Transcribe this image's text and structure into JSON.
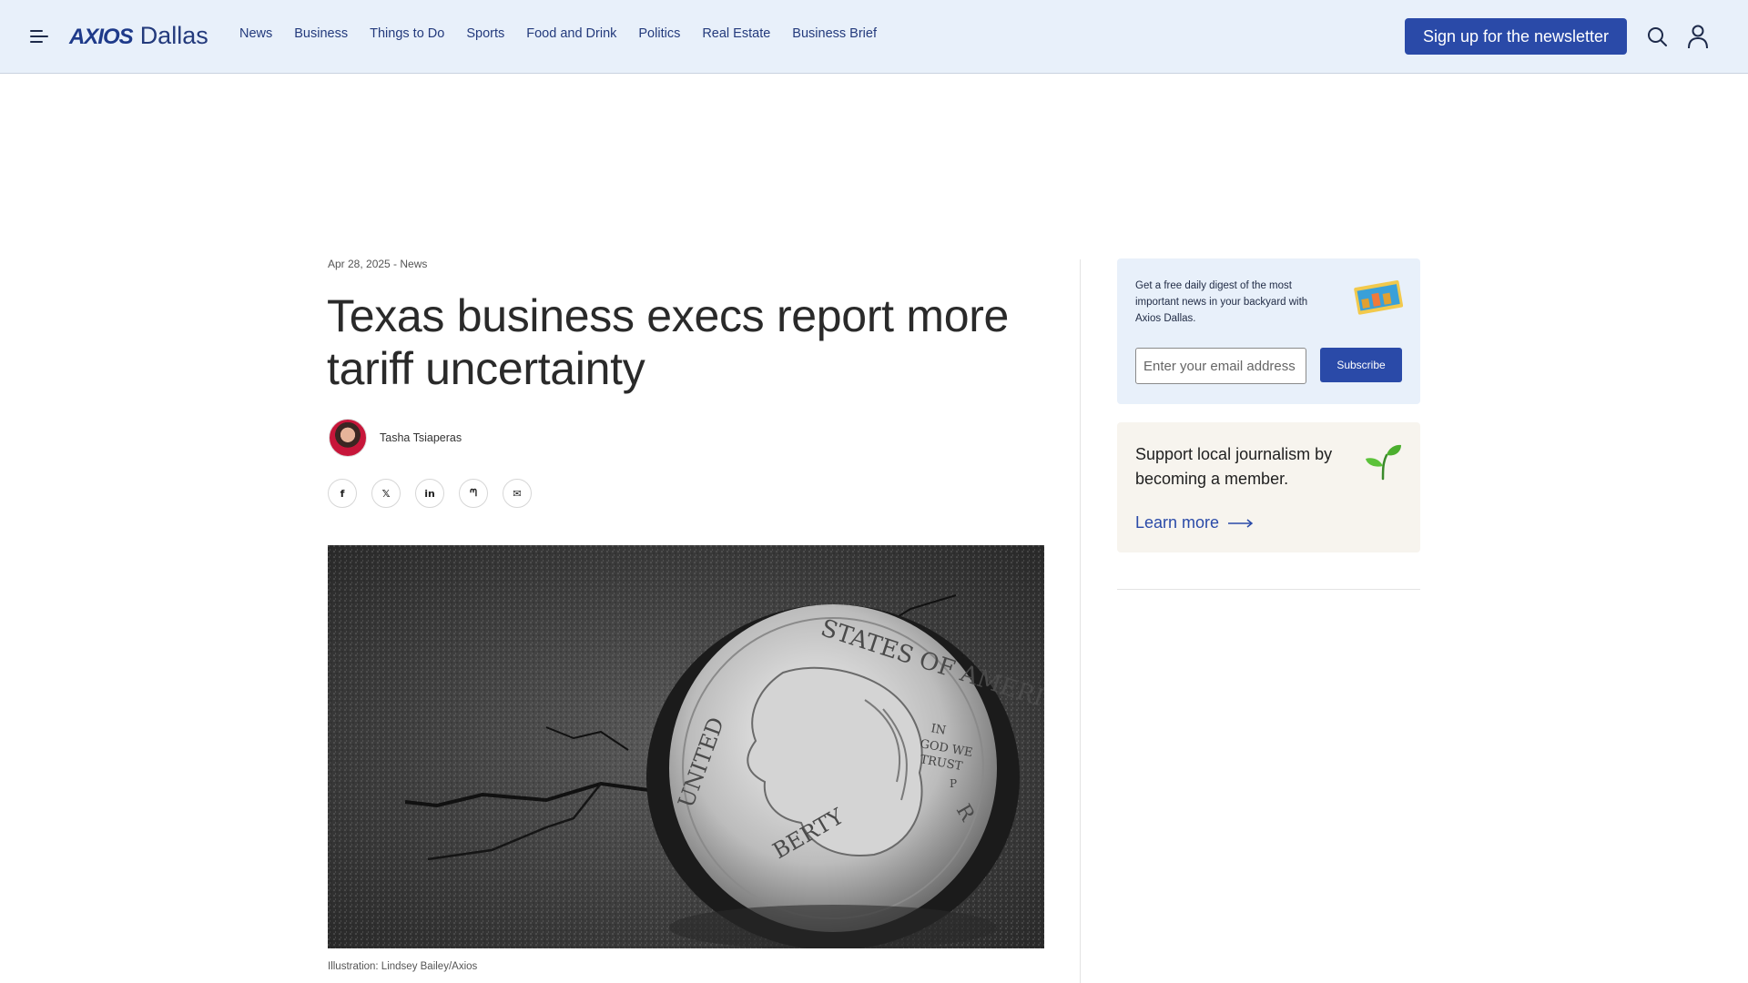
{
  "header": {
    "logo_brand": "AXIOS",
    "logo_city": "Dallas",
    "nav": [
      "News",
      "Business",
      "Things to Do",
      "Sports",
      "Food and Drink",
      "Politics",
      "Real Estate",
      "Business Brief"
    ],
    "signup_label": "Sign up for the newsletter",
    "icons": [
      "menu-icon",
      "search-icon",
      "user-icon"
    ],
    "background_color": "#e8f0fa",
    "accent_color": "#2a4aa8"
  },
  "article": {
    "dateline": "Apr 28, 2025 - News",
    "headline": "Texas business execs report more tariff uncertainty",
    "author": "Tasha Tsiaperas",
    "share_buttons": [
      {
        "name": "facebook",
        "glyph": "f"
      },
      {
        "name": "x",
        "glyph": "𝕏"
      },
      {
        "name": "linkedin",
        "glyph": "in"
      },
      {
        "name": "threads",
        "glyph": "ᘉ"
      },
      {
        "name": "email",
        "glyph": "✉"
      }
    ],
    "caption": "Illustration: Lindsey Bailey/Axios",
    "image_text": {
      "coin_top": "STATES OF AMERICA",
      "coin_left": "UNITED",
      "motto": [
        "IN",
        "GOD WE",
        "TRUST"
      ],
      "mint_mark": "P",
      "coin_bottom": "BERTY",
      "coin_right": "R"
    }
  },
  "sidebar": {
    "newsletter_text": "Get a free daily digest of the most important news in your backyard with Axios Dallas.",
    "email_placeholder": "Enter your email address",
    "subscribe_label": "Subscribe",
    "member_text": "Support local journalism by becoming a member.",
    "learn_more_label": "Learn more",
    "newsletter_bg": "#e8f0fa",
    "member_bg": "#f7f4ee"
  }
}
